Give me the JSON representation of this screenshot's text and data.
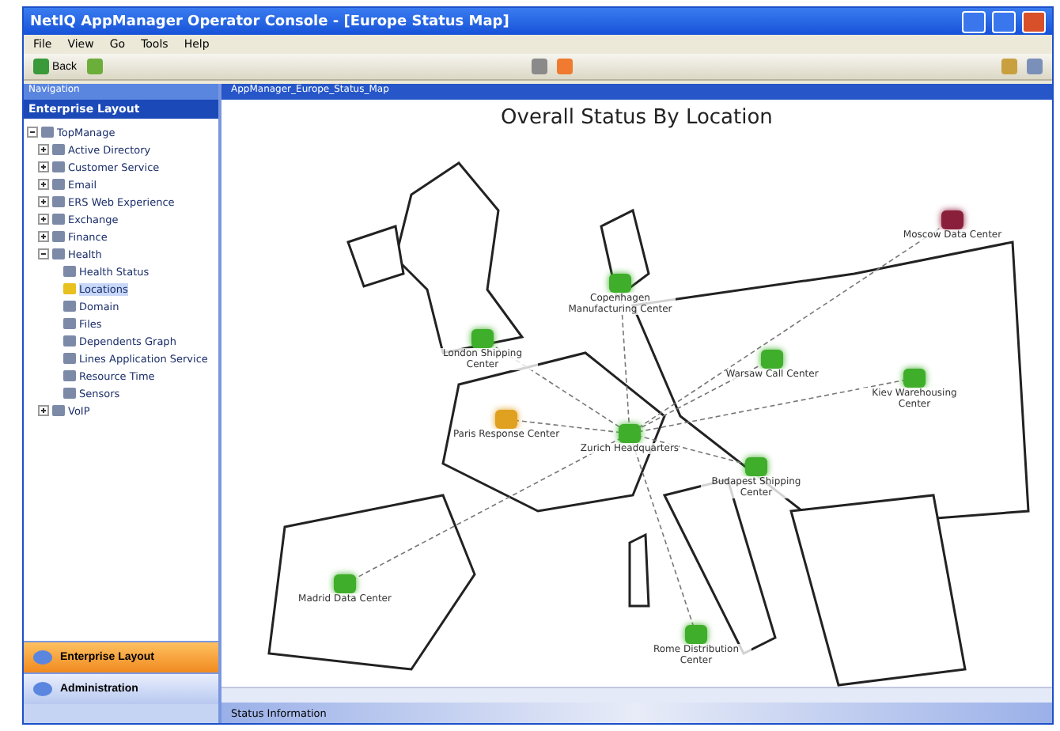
{
  "window": {
    "title": "NetIQ AppManager Operator Console - [Europe Status Map]"
  },
  "menu": [
    "File",
    "View",
    "Go",
    "Tools",
    "Help"
  ],
  "toolbar": {
    "back": "Back"
  },
  "navigation": {
    "title": "Navigation",
    "header": "Enterprise Layout",
    "tree": [
      {
        "label": "TopManage",
        "expanded": true,
        "children": [
          {
            "label": "Active Directory",
            "expanded": false
          },
          {
            "label": "Customer Service",
            "expanded": false
          },
          {
            "label": "Email",
            "expanded": false
          },
          {
            "label": "ERS Web Experience",
            "expanded": false
          },
          {
            "label": "Exchange",
            "expanded": false
          },
          {
            "label": "Finance",
            "expanded": false
          },
          {
            "label": "Health",
            "expanded": true,
            "children": [
              {
                "label": "Health Status",
                "selected": false
              },
              {
                "label": "Locations",
                "selected": true
              },
              {
                "label": "Domain",
                "selected": false
              },
              {
                "label": "Files",
                "selected": false
              },
              {
                "label": "Dependents Graph",
                "selected": false
              },
              {
                "label": "Lines Application Service",
                "selected": false
              },
              {
                "label": "Resource Time",
                "selected": false
              },
              {
                "label": "Sensors",
                "selected": false
              }
            ]
          },
          {
            "label": "VoIP",
            "expanded": false
          }
        ]
      }
    ]
  },
  "panes": [
    {
      "label": "Enterprise Layout",
      "selected": true
    },
    {
      "label": "Administration",
      "selected": false
    }
  ],
  "view": {
    "tab": "AppManager_Europe_Status_Map",
    "title": "Overall Status By Location",
    "nodes": [
      {
        "label": "London Shipping Center",
        "color": "#3fae2a"
      },
      {
        "label": "Copenhagen Manufacturing Center",
        "color": "#3fae2a"
      },
      {
        "label": "Moscow Data Center",
        "color": "#8a1f3c"
      },
      {
        "label": "Warsaw Call Center",
        "color": "#3fae2a"
      },
      {
        "label": "Kiev Warehousing Center",
        "color": "#3fae2a"
      },
      {
        "label": "Paris Response Center",
        "color": "#e0a020"
      },
      {
        "label": "Zurich Headquarters",
        "color": "#3fae2a"
      },
      {
        "label": "Budapest Shipping Center",
        "color": "#3fae2a"
      },
      {
        "label": "Madrid Data Center",
        "color": "#3fae2a"
      },
      {
        "label": "Rome Distribution Center",
        "color": "#3fae2a"
      }
    ]
  },
  "status_bar": {
    "title": "Status Information"
  }
}
